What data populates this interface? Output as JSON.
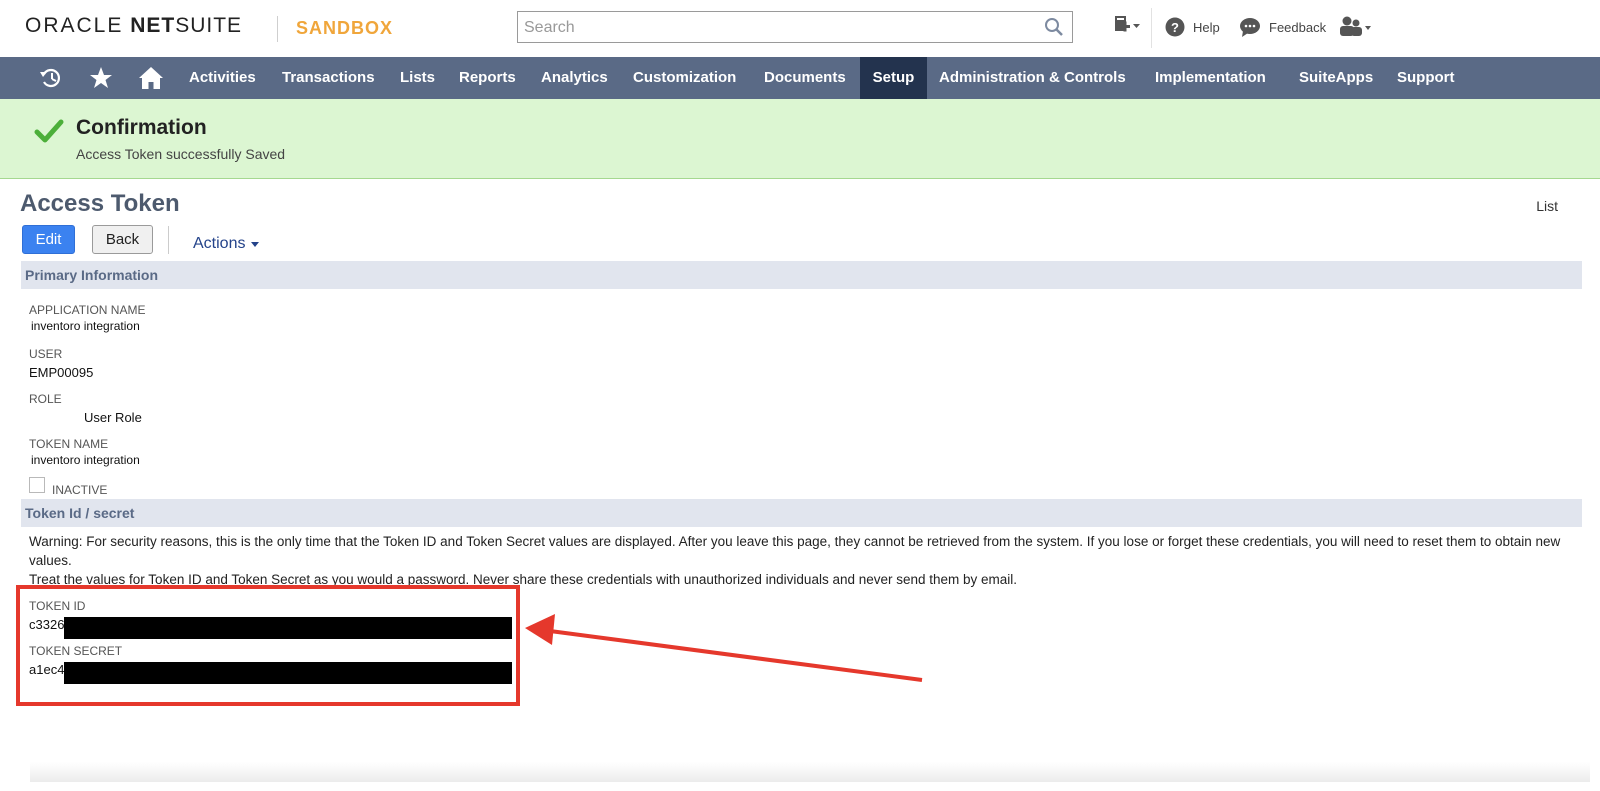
{
  "header": {
    "logo_oracle": "ORACLE",
    "logo_netsuite_bold": "NET",
    "logo_netsuite_rest": "SUITE",
    "environment": "SANDBOX",
    "search_placeholder": "Search",
    "help_label": "Help",
    "feedback_label": "Feedback"
  },
  "nav": {
    "items": [
      "Activities",
      "Transactions",
      "Lists",
      "Reports",
      "Analytics",
      "Customization",
      "Documents",
      "Setup",
      "Administration & Controls",
      "Implementation",
      "SuiteApps",
      "Support"
    ],
    "active": "Setup"
  },
  "confirmation": {
    "title": "Confirmation",
    "message": "Access Token successfully Saved"
  },
  "page": {
    "title": "Access Token",
    "list_link": "List",
    "edit_button": "Edit",
    "back_button": "Back",
    "actions_menu": "Actions"
  },
  "primary": {
    "section_title": "Primary Information",
    "application_name_label": "APPLICATION NAME",
    "application_name_value": "inventoro integration",
    "user_label": "USER",
    "user_value": "EMP00095",
    "role_label": "ROLE",
    "role_value": "User Role",
    "token_name_label": "TOKEN NAME",
    "token_name_value": "inventoro integration",
    "inactive_label": "INACTIVE"
  },
  "token": {
    "section_title": "Token Id / secret",
    "warning_line1": "Warning: For security reasons, this is the only time that the Token ID and Token Secret values are displayed. After you leave this page, they cannot be retrieved from the system. If you lose or forget these credentials, you will need to reset them to obtain new values.",
    "warning_line2": "Treat the values for Token ID and Token Secret as you would a password. Never share these credentials with unauthorized individuals and never send them by email.",
    "token_id_label": "TOKEN ID",
    "token_id_value": "c3326",
    "token_secret_label": "TOKEN SECRET",
    "token_secret_value": "a1ec4"
  },
  "colors": {
    "nav_bg": "#5a6a86",
    "nav_active": "#23334e",
    "confirm_bg": "#dcf6d2",
    "annotation_red": "#e5382c",
    "sandbox_orange": "#f0a63b",
    "edit_blue": "#3b82f0"
  }
}
